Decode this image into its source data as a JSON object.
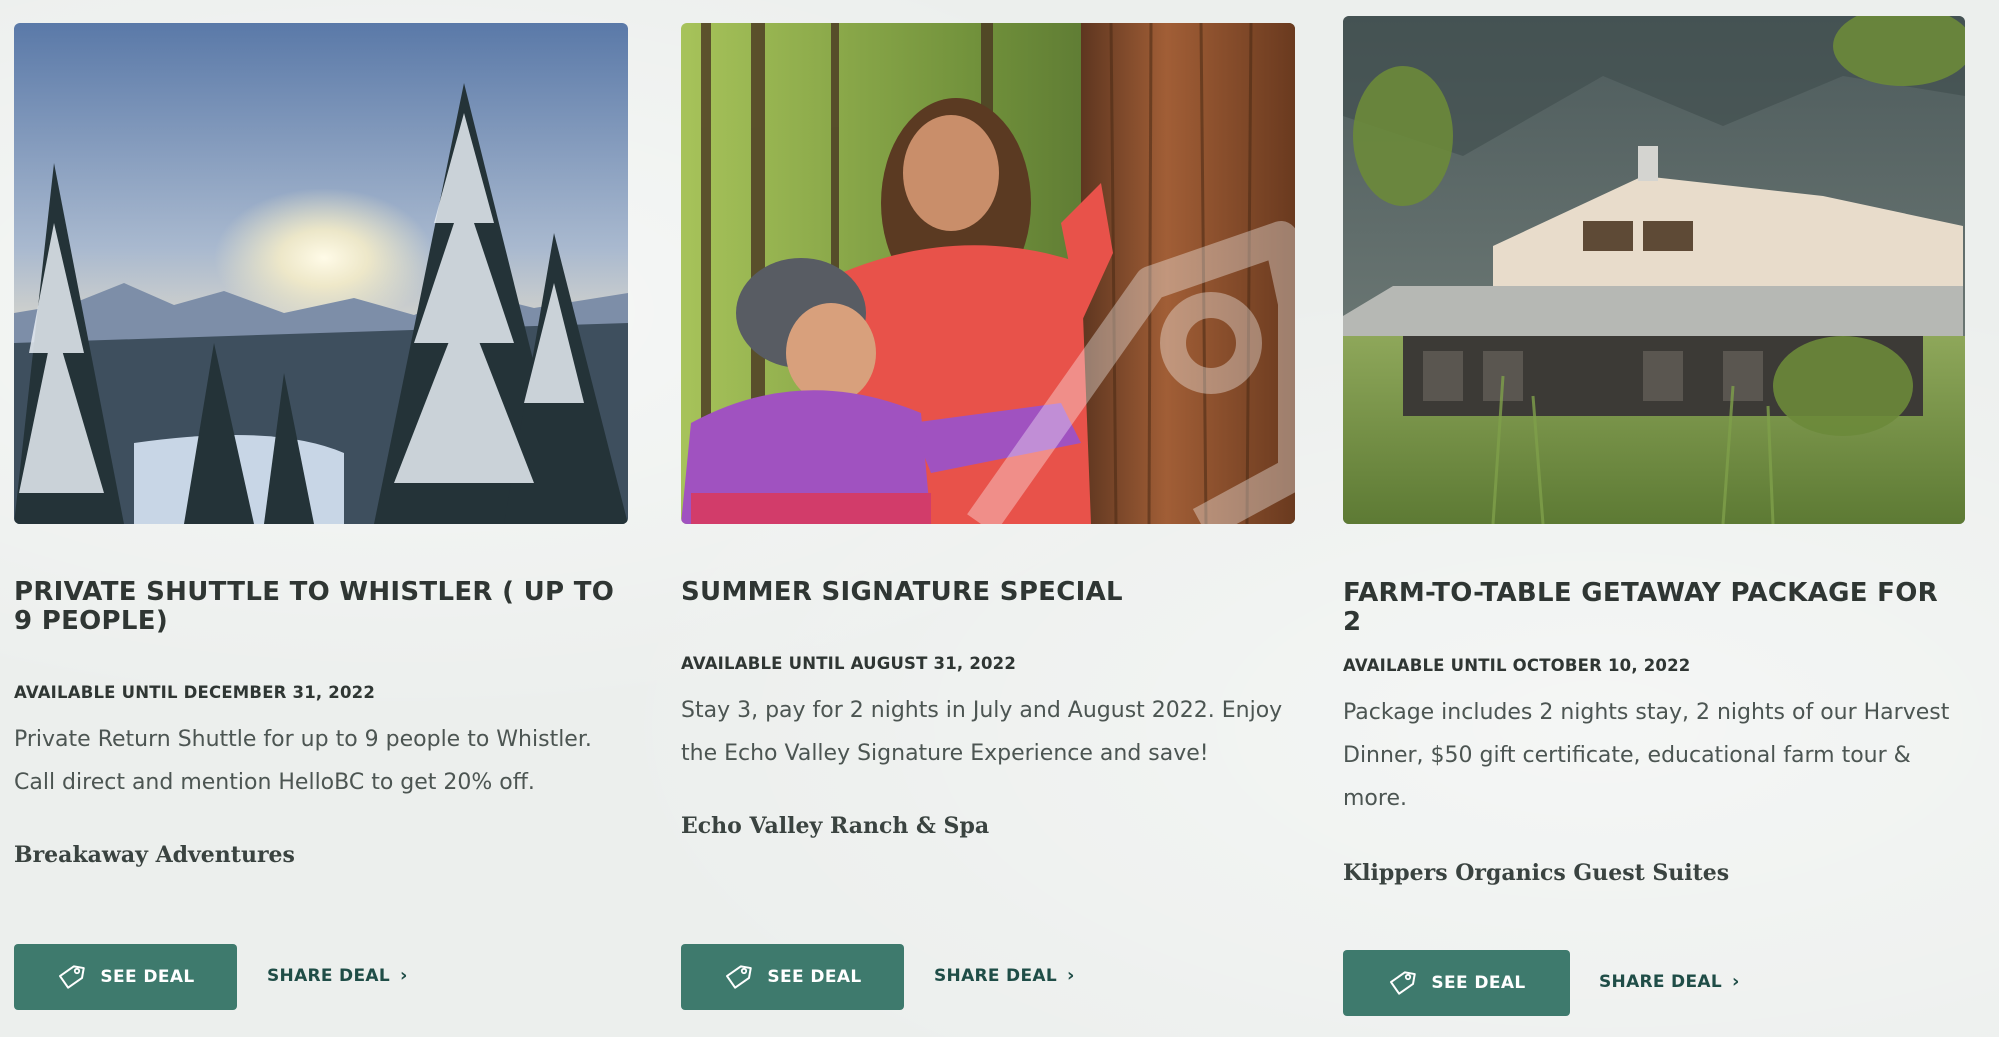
{
  "deals": [
    {
      "title": "PRIVATE SHUTTLE TO WHISTLER ( UP TO 9 PEOPLE)",
      "availability": "AVAILABLE UNTIL DECEMBER 31, 2022",
      "description": "Private Return Shuttle for up to 9 people to Whistler. Call direct and mention HelloBC to get 20% off.",
      "operator": "Breakaway Adventures",
      "see_deal_label": "SEE DEAL",
      "share_deal_label": "SHARE DEAL",
      "image_icon": "snowy-mountain-forest-photo"
    },
    {
      "title": "SUMMER SIGNATURE SPECIAL",
      "availability": "AVAILABLE UNTIL AUGUST 31, 2022",
      "description": "Stay 3, pay for 2 nights in July and August 2022. Enjoy the Echo Valley Signature Experience and save!",
      "operator": "Echo Valley Ranch & Spa",
      "see_deal_label": "SEE DEAL",
      "share_deal_label": "SHARE DEAL",
      "image_icon": "children-in-forest-photo"
    },
    {
      "title": "FARM-TO-TABLE GETAWAY PACKAGE FOR 2",
      "availability": "AVAILABLE UNTIL OCTOBER 10, 2022",
      "description": "Package includes 2 nights stay, 2 nights of our Harvest Dinner, $50 gift certificate, educational farm tour & more.",
      "operator": "Klippers Organics Guest Suites",
      "see_deal_label": "SEE DEAL",
      "share_deal_label": "SHARE DEAL",
      "image_icon": "farmhouse-meadow-photo"
    }
  ],
  "colors": {
    "button": "#3e7a6d",
    "link": "#1f4d47",
    "background": "#ecefed"
  }
}
